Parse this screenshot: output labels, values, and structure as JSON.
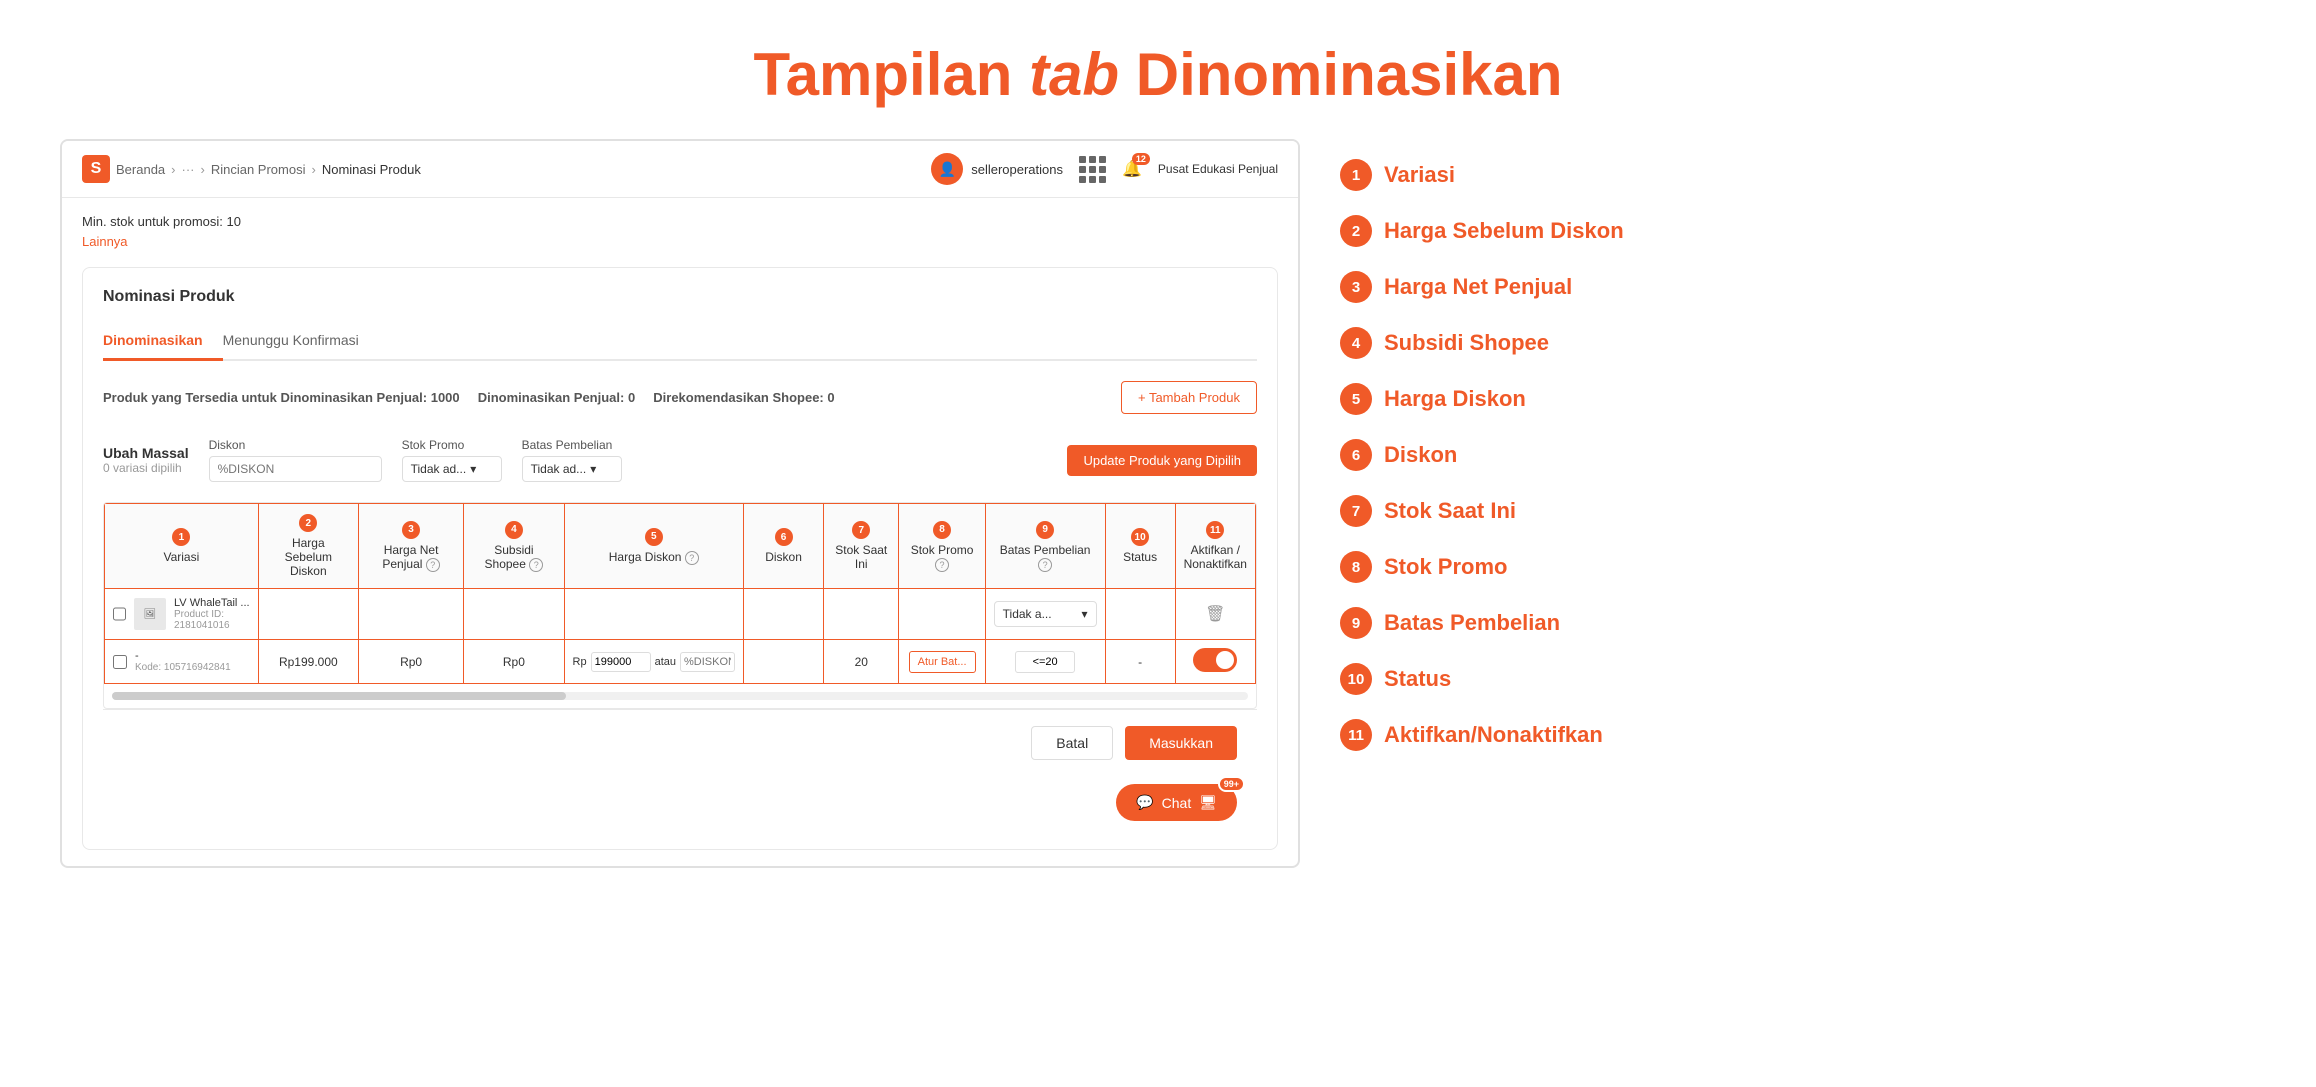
{
  "page": {
    "title_normal": "Tampilan ",
    "title_italic": "tab",
    "title_suffix": " Dinominasikan"
  },
  "topbar": {
    "logo": "S",
    "breadcrumbs": [
      "Beranda",
      "...",
      "Rincian Promosi",
      "Nominasi Produk"
    ],
    "user": "selleroperations",
    "notif_count": "12",
    "edu_label": "Pusat Edukasi Penjual"
  },
  "content": {
    "min_stok": "Min. stok untuk promosi: 10",
    "lainnya": "Lainnya"
  },
  "card": {
    "title": "Nominasi Produk",
    "tabs": [
      "Dinominasikan",
      "Menunggu Konfirmasi"
    ],
    "active_tab": 0,
    "stats": {
      "tersedia_label": "Produk yang Tersedia untuk Dinominasikan Penjual:",
      "tersedia_value": "1000",
      "dinominasikan_label": "Dinominasikan Penjual:",
      "dinominasikan_value": "0",
      "direkomendasikan_label": "Direkomendasikan Shopee:",
      "direkomendasikan_value": "0"
    },
    "add_btn": "+ Tambah Produk",
    "ubah_massal": {
      "title": "Ubah Massal",
      "subtitle": "0 variasi dipilih",
      "diskon_label": "Diskon",
      "diskon_placeholder": "%DISKON",
      "stok_promo_label": "Stok Promo",
      "stok_promo_value": "Tidak ad...",
      "batas_pembelian_label": "Batas Pembelian",
      "batas_pembelian_value": "Tidak ad...",
      "update_btn": "Update Produk yang Dipilih"
    },
    "table": {
      "headers": [
        {
          "num": "1",
          "label": "Variasi"
        },
        {
          "num": "2",
          "label": "Harga Sebelum Diskon"
        },
        {
          "num": "3",
          "label": "Harga Net Penjual"
        },
        {
          "num": "4",
          "label": "Subsidi Shopee"
        },
        {
          "num": "5",
          "label": "Harga Diskon"
        },
        {
          "num": "6",
          "label": "Diskon"
        },
        {
          "num": "7",
          "label": "Stok Saat Ini"
        },
        {
          "num": "8",
          "label": "Stok Promo"
        },
        {
          "num": "9",
          "label": "Batas Pembelian"
        },
        {
          "num": "10",
          "label": "Status"
        },
        {
          "num": "11",
          "label": "Aktifkan / Nonaktifkan"
        }
      ],
      "rows": [
        {
          "product_name": "LV WhaleTail ...",
          "product_id": "Product ID: 2181041016",
          "harga_sebelum": "",
          "harga_net": "",
          "subsidi": "",
          "harga_diskon": "",
          "diskon": "",
          "stok_saat_ini": "",
          "stok_promo": "",
          "batas": "Tidak a...",
          "status": "",
          "aktif": ""
        },
        {
          "product_name": "-",
          "kode": "Kode: 105716942841",
          "harga_sebelum": "Rp199.000",
          "harga_net": "Rp0",
          "subsidi": "Rp0",
          "harga_diskon_rp": "Rp  199000",
          "harga_diskon_pct": "%DISKON",
          "atau": "atau",
          "diskon": "",
          "stok_saat_ini": "20",
          "stok_promo": "Atur Bat...",
          "batas": "<=20",
          "status": "-",
          "aktif": "on"
        }
      ]
    },
    "batal": "Batal",
    "masukkan": "Masukkan"
  },
  "chat": {
    "label": "Chat",
    "badge": "99+"
  },
  "legend": {
    "items": [
      {
        "num": "1",
        "label": "Variasi"
      },
      {
        "num": "2",
        "label": "Harga Sebelum Diskon"
      },
      {
        "num": "3",
        "label": "Harga Net Penjual"
      },
      {
        "num": "4",
        "label": "Subsidi Shopee"
      },
      {
        "num": "5",
        "label": "Harga Diskon"
      },
      {
        "num": "6",
        "label": "Diskon"
      },
      {
        "num": "7",
        "label": "Stok Saat Ini"
      },
      {
        "num": "8",
        "label": "Stok Promo"
      },
      {
        "num": "9",
        "label": "Batas Pembelian"
      },
      {
        "num": "10",
        "label": "Status"
      },
      {
        "num": "11",
        "label": "Aktifkan/Nonaktifkan"
      }
    ]
  }
}
